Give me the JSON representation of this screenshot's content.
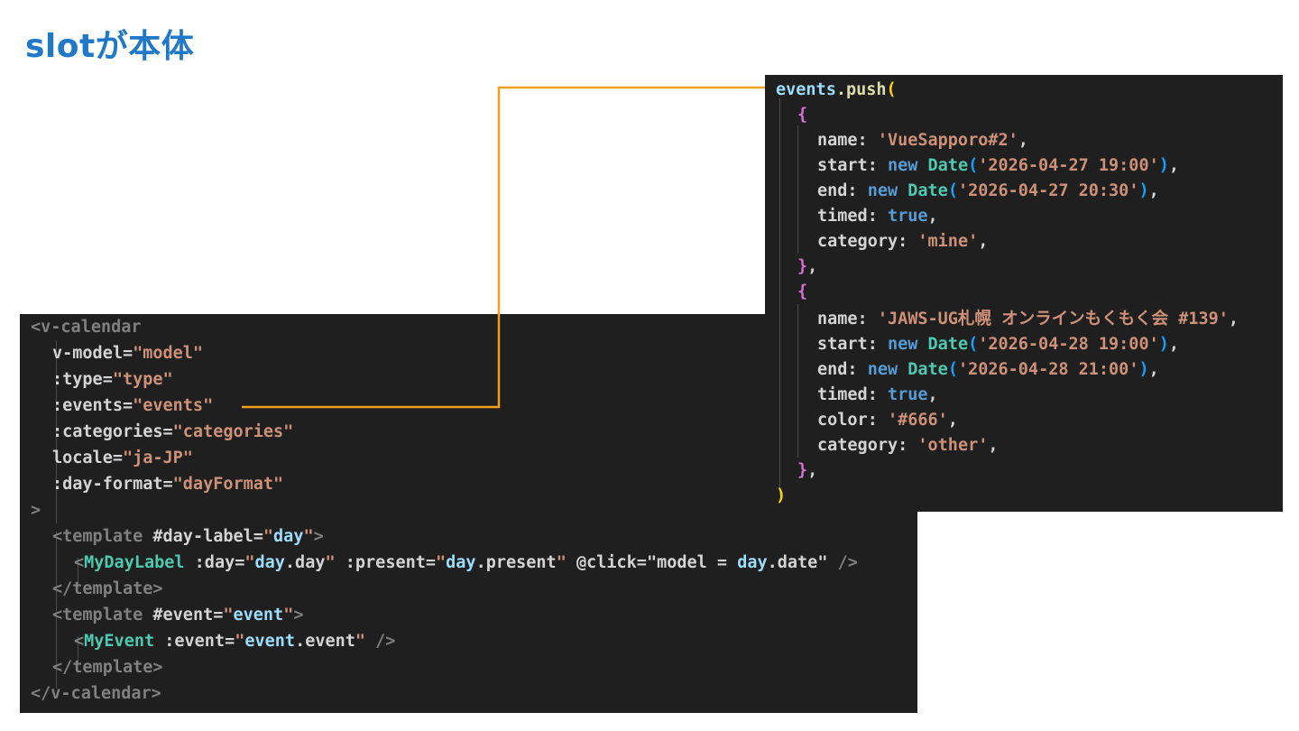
{
  "title": "slotが本体",
  "accent_color": "#1f78c8",
  "connector_color": "#f0a020",
  "template_code": {
    "l1": "<v-calendar",
    "l2_attr": "v-model=",
    "l2_val": "\"model\"",
    "l3_attr": ":type=",
    "l3_val": "\"type\"",
    "l4_attr": ":events=",
    "l4_val": "\"events\"",
    "l5_attr": ":categories=",
    "l5_val": "\"categories\"",
    "l6_attr": "locale=",
    "l6_val": "\"ja-JP\"",
    "l7_attr": ":day-format=",
    "l7_val": "\"dayFormat\"",
    "l8": ">",
    "l9_open": "<template",
    "l9_attr": " #day-label=",
    "l9_q": "\"",
    "l9_val": "day",
    "l9_close": ">",
    "l10_open": "<MyDayLabel",
    "l10_a1": " :day=",
    "l10_v1a": "\"",
    "l10_v1b": "day",
    "l10_v1c": ".day",
    "l10_v1d": "\"",
    "l10_a2": " :present=",
    "l10_v2a": "\"",
    "l10_v2b": "day",
    "l10_v2c": ".present",
    "l10_v2d": "\"",
    "l10_a3": " @click=",
    "l10_v3a": "\"model = ",
    "l10_v3b": "day",
    "l10_v3c": ".date",
    "l10_v3d": "\"",
    "l10_close": " />",
    "l11": "</template>",
    "l12_open": "<template",
    "l12_attr": " #event=",
    "l12_q": "\"",
    "l12_val": "event",
    "l12_close": ">",
    "l13_open": "<MyEvent",
    "l13_attr": " :event=",
    "l13_va": "\"",
    "l13_vb": "event",
    "l13_vc": ".event",
    "l13_vd": "\"",
    "l13_close": " />",
    "l14": "</template>",
    "l15": "</v-calendar>"
  },
  "script_code": {
    "l1_obj": "events",
    "l1_fn": ".push",
    "l1_paren": "(",
    "brace_open": "{",
    "e1_name_key": "name: ",
    "e1_name_val": "'VueSapporo#2'",
    "e1_start_key": "start: ",
    "e1_start_new": "new ",
    "e1_start_cls": "Date",
    "e1_start_val": "'2026-04-27 19:00'",
    "e1_end_key": "end: ",
    "e1_end_new": "new ",
    "e1_end_cls": "Date",
    "e1_end_val": "'2026-04-27 20:30'",
    "e1_timed_key": "timed: ",
    "e1_timed_val": "true",
    "e1_cat_key": "category: ",
    "e1_cat_val": "'mine'",
    "brace_close": "}",
    "e2_name_key": "name: ",
    "e2_name_val": "'JAWS-UG札幌 オンラインもくもく会 #139'",
    "e2_start_key": "start: ",
    "e2_start_new": "new ",
    "e2_start_cls": "Date",
    "e2_start_val": "'2026-04-28 19:00'",
    "e2_end_key": "end: ",
    "e2_end_new": "new ",
    "e2_end_cls": "Date",
    "e2_end_val": "'2026-04-28 21:00'",
    "e2_timed_key": "timed: ",
    "e2_timed_val": "true",
    "e2_color_key": "color: ",
    "e2_color_val": "'#666'",
    "e2_cat_key": "category: ",
    "e2_cat_val": "'other'",
    "close_paren": ")"
  }
}
